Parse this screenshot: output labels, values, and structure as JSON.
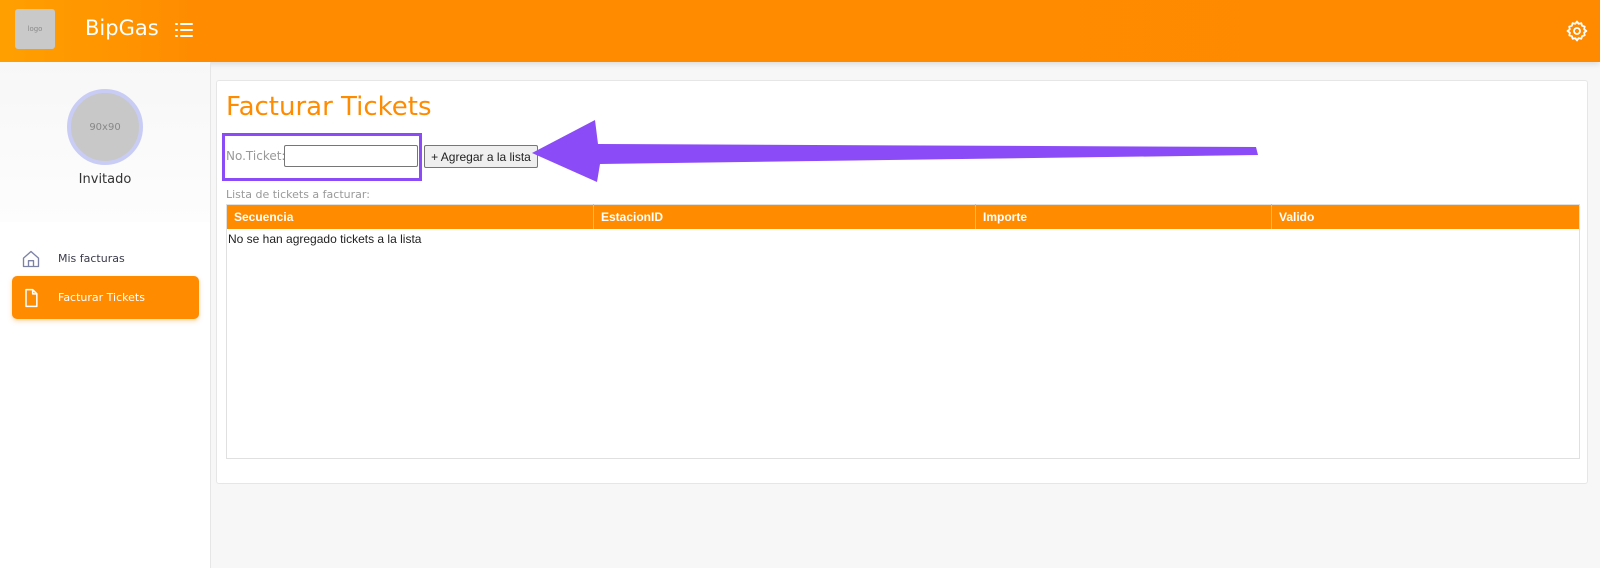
{
  "header": {
    "logo_text": "logo",
    "brand": "BipGas",
    "menu_icon": "list-icon",
    "settings_icon": "gear-icon"
  },
  "sidebar": {
    "avatar_text": "90x90",
    "user_name": "Invitado",
    "items": [
      {
        "label": "Mis facturas",
        "icon": "home-icon",
        "active": false
      },
      {
        "label": "Facturar Tickets",
        "icon": "document-icon",
        "active": true
      }
    ]
  },
  "main": {
    "title": "Facturar Tickets",
    "ticket_label": "No.Ticket:",
    "ticket_value": "",
    "add_button": "+ Agregar a la lista",
    "list_label": "Lista de tickets a facturar:",
    "table": {
      "columns": [
        "Secuencia",
        "EstacionID",
        "Importe",
        "Valido"
      ],
      "empty_message": "No se han agregado tickets a la lista"
    }
  },
  "colors": {
    "accent": "#ff8c00",
    "annotation": "#8b4cf7"
  }
}
